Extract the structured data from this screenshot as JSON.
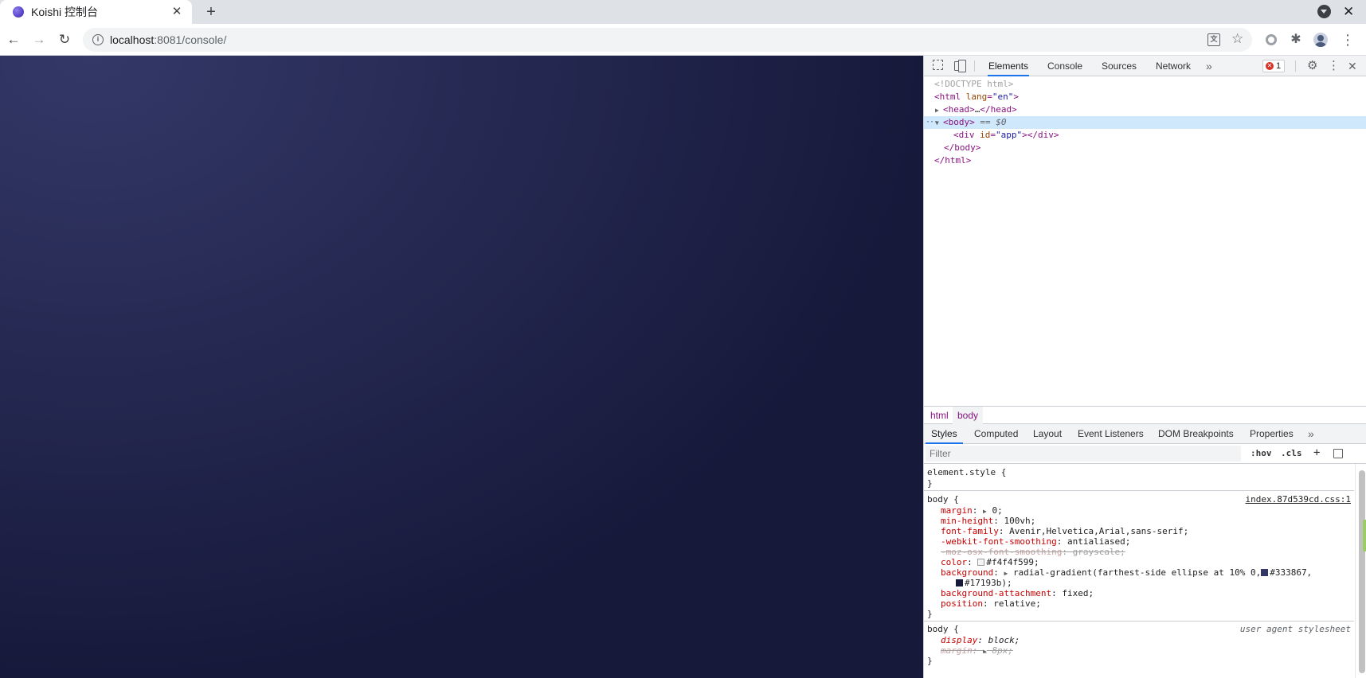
{
  "browser": {
    "tab_title": "Koishi 控制台",
    "tab_close": "✕",
    "new_tab": "+",
    "url_host": "localhost",
    "url_rest": ":8081/console/",
    "back": "←",
    "forward": "→",
    "reload": "↻",
    "star": "☆",
    "menu": "⋮",
    "extensions": "✱",
    "window_close": "✕"
  },
  "viewport": {
    "gradient_from": "#333867",
    "gradient_to": "#17193b"
  },
  "devtools": {
    "tabs": [
      "Elements",
      "Console",
      "Sources",
      "Network"
    ],
    "more": "»",
    "error_count": "1",
    "settings": "⚙",
    "menu": "⋮",
    "close": "✕",
    "dom": {
      "doctype": "<!DOCTYPE html>",
      "html_open_tag": "html",
      "html_attr": "lang",
      "html_val": "\"en\"",
      "head_tag": "head",
      "head_ellipsis": "…",
      "body_tag": "body",
      "body_marker": "== $0",
      "div_tag": "div",
      "div_attr": "id",
      "div_val": "\"app\"",
      "body_close": "</body>",
      "html_close": "</html>",
      "dots": "···"
    },
    "breadcrumbs": [
      "html",
      "body"
    ],
    "sub_tabs": [
      "Styles",
      "Computed",
      "Layout",
      "Event Listeners",
      "DOM Breakpoints",
      "Properties"
    ],
    "filter_placeholder": "Filter",
    "filter_tools": [
      ":hov",
      ".cls",
      "+"
    ],
    "styles": {
      "element_style": "element.style {",
      "close_brace": "}",
      "body_selector": "body {",
      "body_source": "index.87d539cd.css:1",
      "props": [
        {
          "name": "margin",
          "value": "0;"
        },
        {
          "name": "min-height",
          "value": "100vh;"
        },
        {
          "name": "font-family",
          "value": "Avenir,Helvetica,Arial,sans-serif;"
        },
        {
          "name": "-webkit-font-smoothing",
          "value": "antialiased;"
        },
        {
          "name": "-moz-osx-font-smoothing",
          "value": "grayscale;"
        },
        {
          "name": "color",
          "value": "#f4f4f599;"
        },
        {
          "name": "background",
          "value": "radial-gradient(farthest-side ellipse at 10% 0,"
        },
        {
          "name": "",
          "value": "#333867,"
        },
        {
          "name": "",
          "value": "#17193b);"
        },
        {
          "name": "background-attachment",
          "value": "fixed;"
        },
        {
          "name": "position",
          "value": "relative;"
        }
      ],
      "ua_selector": "body {",
      "ua_label": "user agent stylesheet",
      "ua_props": [
        {
          "name": "display",
          "value": "block;"
        },
        {
          "name": "margin",
          "value": "8px;"
        }
      ]
    }
  }
}
